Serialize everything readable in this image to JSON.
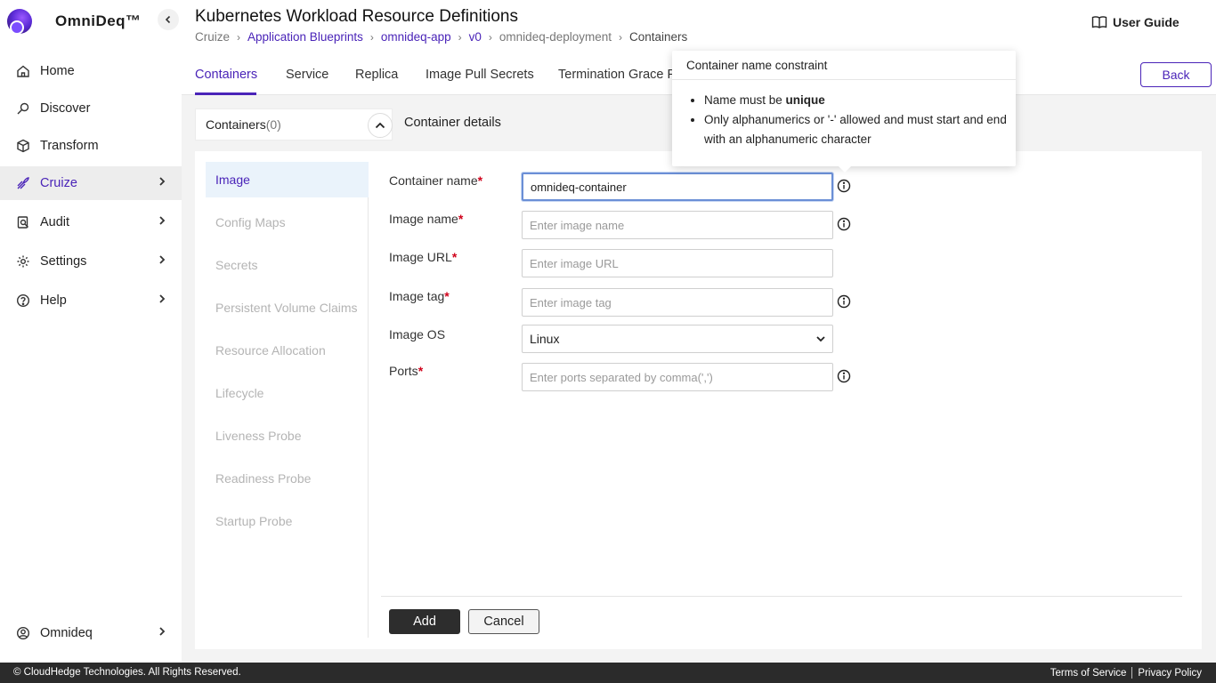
{
  "app": {
    "name": "OmniDeq™"
  },
  "sidebar": {
    "items": [
      {
        "label": "Home",
        "icon": "home-icon"
      },
      {
        "label": "Discover",
        "icon": "discover-icon"
      },
      {
        "label": "Transform",
        "icon": "cube-icon"
      },
      {
        "label": "Cruize",
        "icon": "cruize-icon",
        "active": true
      },
      {
        "label": "Audit",
        "icon": "audit-icon"
      },
      {
        "label": "Settings",
        "icon": "gear-icon"
      },
      {
        "label": "Help",
        "icon": "help-icon"
      }
    ],
    "user": {
      "label": "Omnideq"
    }
  },
  "header": {
    "title": "Kubernetes Workload Resource Definitions",
    "breadcrumb": [
      "Cruize",
      "Application Blueprints",
      "omnideq-app",
      "v0",
      "omnideq-deployment",
      "Containers"
    ],
    "user_guide": "User Guide"
  },
  "tabs": [
    "Containers",
    "Service",
    "Replica",
    "Image Pull Secrets",
    "Termination Grace P"
  ],
  "back_label": "Back",
  "containers": {
    "label": "Containers",
    "count": "(0)",
    "details_title": "Container details"
  },
  "side_menu": [
    "Image",
    "Config Maps",
    "Secrets",
    "Persistent Volume Claims",
    "Resource Allocation",
    "Lifecycle",
    "Liveness Probe",
    "Readiness Probe",
    "Startup Probe"
  ],
  "form": {
    "container_name": {
      "label": "Container name",
      "value": "omnideq-container"
    },
    "image_name": {
      "label": "Image name",
      "placeholder": "Enter image name"
    },
    "image_url": {
      "label": "Image URL",
      "placeholder": "Enter image URL"
    },
    "image_tag": {
      "label": "Image tag",
      "placeholder": "Enter image tag"
    },
    "image_os": {
      "label": "Image OS",
      "value": "Linux"
    },
    "ports": {
      "label": "Ports",
      "placeholder": "Enter ports separated by comma(',')"
    },
    "required_mark": "*"
  },
  "buttons": {
    "add": "Add",
    "cancel": "Cancel"
  },
  "tooltip": {
    "title": "Container name constraint",
    "rule1_prefix": "Name must be ",
    "rule1_bold": "unique",
    "rule2": "Only alphanumerics or '-' allowed and must start and end with an alphanumeric character"
  },
  "footer": {
    "copyright": "© CloudHedge Technologies. All Rights Reserved.",
    "terms": "Terms of Service",
    "privacy": "Privacy Policy"
  },
  "colors": {
    "accent": "#4a24b8",
    "footer_bg": "#2b2b2b",
    "active_menu_bg": "#eaf3fb"
  }
}
